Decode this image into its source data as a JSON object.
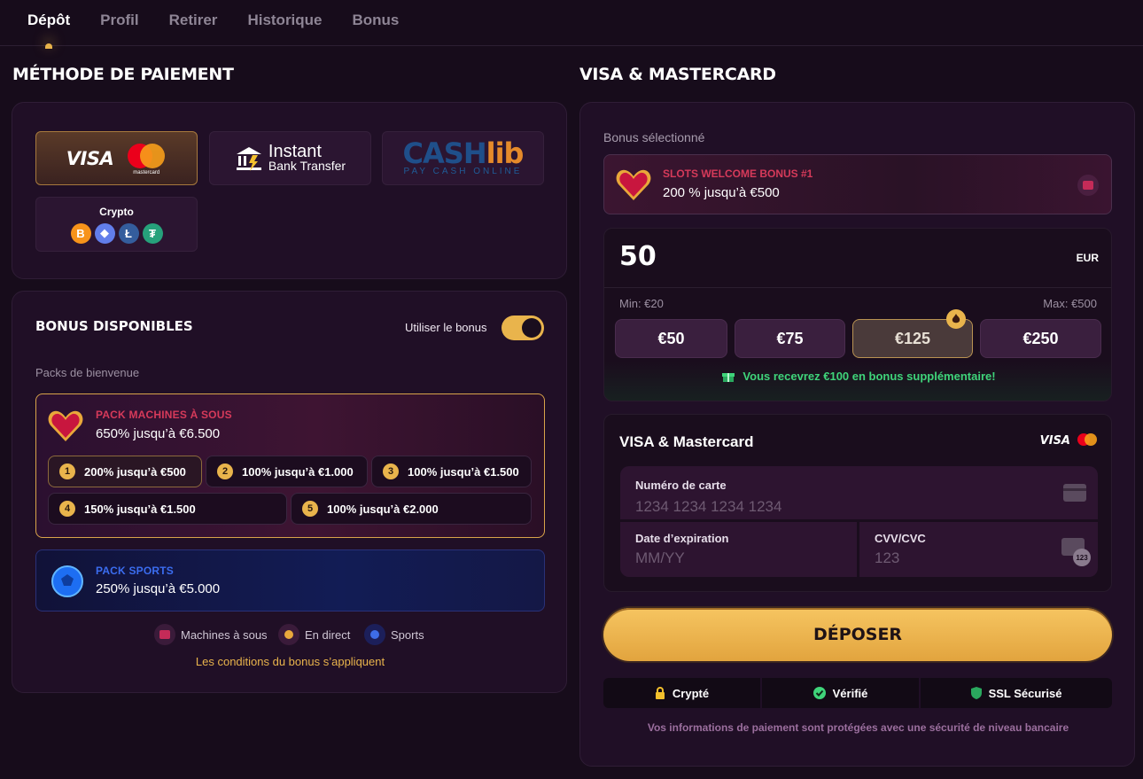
{
  "tabs": [
    "Dépôt",
    "Profil",
    "Retirer",
    "Historique",
    "Bonus"
  ],
  "left": {
    "title": "MÉTHODE DE PAIEMENT",
    "methods": {
      "visa": "VISA",
      "mastercard": "mastercard",
      "instant_line1": "Instant",
      "instant_line2": "Bank Transfer",
      "cashlib_cash": "CASH",
      "cashlib_lib": "lib",
      "cashlib_sub": "PAY CASH ONLINE",
      "crypto": "Crypto",
      "coins": [
        "B",
        "◆",
        "Ł",
        "₮"
      ]
    },
    "bonuses": {
      "title": "BONUS DISPONIBLES",
      "toggle_label": "Utiliser le bonus",
      "toggle_on": true,
      "packs_label": "Packs de bienvenue",
      "slots": {
        "title": "PACK MACHINES À SOUS",
        "subtitle": "650% jusqu’à €6.500",
        "tiers": [
          {
            "n": "1",
            "label": "200% jusqu’à €500"
          },
          {
            "n": "2",
            "label": "100% jusqu’à €1.000"
          },
          {
            "n": "3",
            "label": "100% jusqu’à €1.500"
          },
          {
            "n": "4",
            "label": "150% jusqu’à €1.500"
          },
          {
            "n": "5",
            "label": "100% jusqu’à €2.000"
          }
        ]
      },
      "sports": {
        "title": "PACK SPORTS",
        "subtitle": "250% jusqu’à €5.000"
      },
      "categories": [
        "Machines à sous",
        "En direct",
        "Sports"
      ],
      "conditions": "Les conditions du bonus s’appliquent"
    }
  },
  "right": {
    "title": "VISA & MASTERCARD",
    "selected_label": "Bonus sélectionné",
    "selected_bonus": {
      "title": "SLOTS WELCOME BONUS #1",
      "subtitle": "200 % jusqu’à €500"
    },
    "amount": "50",
    "currency": "EUR",
    "min": "Min: €20",
    "max": "Max: €500",
    "chips": [
      "€50",
      "€75",
      "€125",
      "€250"
    ],
    "bonus_msg": "Vous recevrez €100 en bonus supplémentaire!",
    "card": {
      "title": "VISA & Mastercard",
      "visa": "VISA",
      "number_label": "Numéro de carte",
      "number_placeholder": "1234 1234 1234 1234",
      "expiry_label": "Date d’expiration",
      "expiry_placeholder": "MM/YY",
      "cvv_label": "CVV/CVC",
      "cvv_placeholder": "123",
      "cvv_badge": "123"
    },
    "deposit": "DÉPOSER",
    "badges": [
      "Crypté",
      "Vérifié",
      "SSL Sécurisé"
    ],
    "footer": "Vos informations de paiement sont protégées avec une sécurité de niveau bancaire"
  },
  "colors": {
    "accent": "#e9b44c",
    "bg": "#170c1b",
    "panel": "#200f26",
    "slots_title": "#d63a5a",
    "sports_title": "#3b6df0",
    "bonus_green": "#3fd47a"
  }
}
